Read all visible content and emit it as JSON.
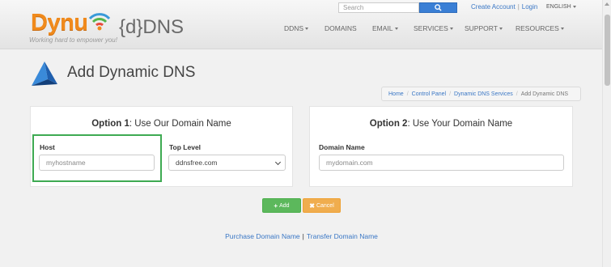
{
  "brand": {
    "name": "Dynu",
    "product": "{d}DNS",
    "tagline": "Working hard to empower you!",
    "colors": {
      "orange": "#f08a1c",
      "blue": "#3a7fd5",
      "green": "#5cb85c",
      "warning": "#f0ad4e",
      "highlight": "#3eaa52"
    }
  },
  "search": {
    "placeholder": "Search",
    "icon": "search-icon"
  },
  "account": {
    "create": "Create Account",
    "login": "Login"
  },
  "language": {
    "label": "ENGLISH"
  },
  "nav": {
    "items": [
      "DDNS",
      "DOMAINS",
      "EMAIL",
      "SERVICES",
      "SUPPORT",
      "RESOURCES"
    ]
  },
  "page": {
    "title": "Add Dynamic DNS"
  },
  "breadcrumb": {
    "items": [
      "Home",
      "Control Panel",
      "Dynamic DNS Services",
      "Add Dynamic DNS"
    ]
  },
  "option1": {
    "title_strong": "Option 1",
    "title_rest": ": Use Our Domain Name",
    "host_label": "Host",
    "host_placeholder": "myhostname",
    "top_level_label": "Top Level",
    "top_level_value": "ddnsfree.com"
  },
  "option2": {
    "title_strong": "Option 2",
    "title_rest": ": Use Your Domain Name",
    "domain_label": "Domain Name",
    "domain_placeholder": "mydomain.com"
  },
  "buttons": {
    "add": "Add",
    "cancel": "Cancel"
  },
  "links": {
    "purchase": "Purchase Domain Name",
    "separator": "|",
    "transfer": "Transfer Domain Name"
  }
}
